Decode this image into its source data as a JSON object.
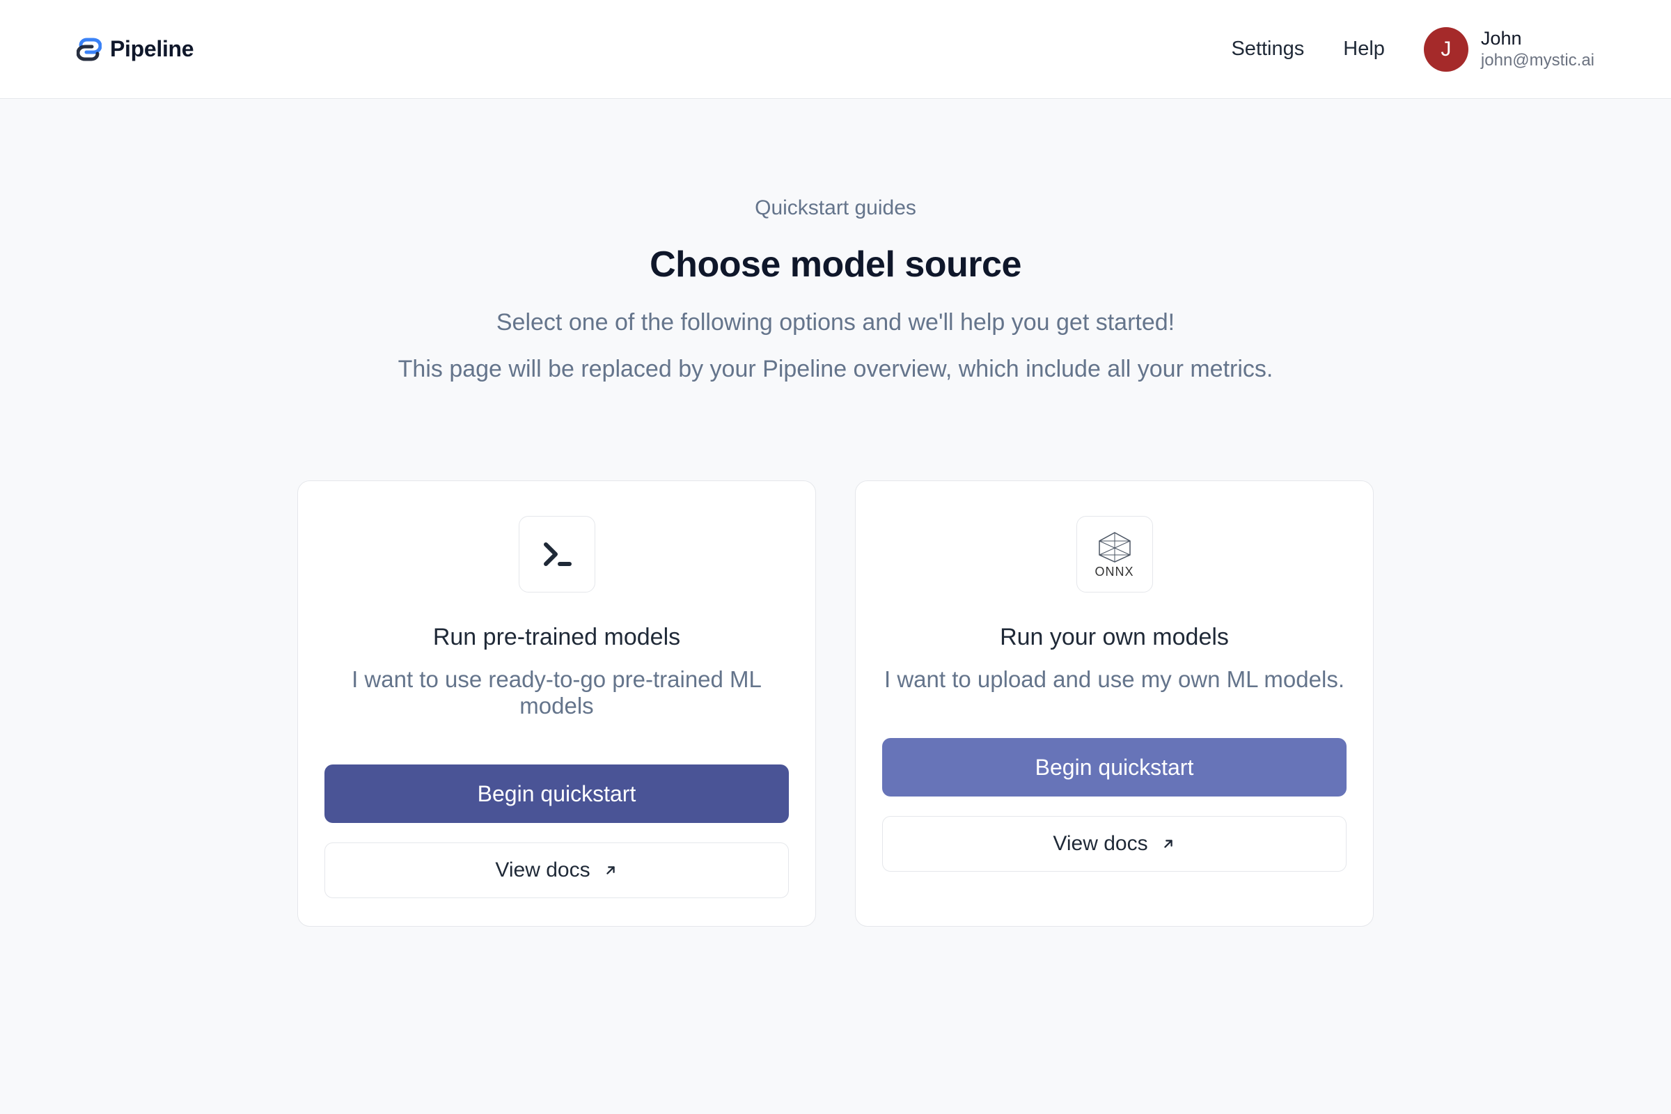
{
  "brand": {
    "name": "Pipeline"
  },
  "nav": {
    "settings": "Settings",
    "help": "Help"
  },
  "user": {
    "initial": "J",
    "name": "John",
    "email": "john@mystic.ai"
  },
  "page": {
    "eyebrow": "Quickstart guides",
    "title": "Choose model source",
    "subtitle": "Select one of the following options and we'll help you get started!",
    "subtitle2": "This page will be replaced by your Pipeline overview, which include all your metrics."
  },
  "cards": [
    {
      "icon_name": "terminal-icon",
      "icon_label": "",
      "title": "Run pre-trained models",
      "desc": "I want to use ready-to-go pre-trained ML models",
      "primary_label": "Begin quickstart",
      "secondary_label": "View docs"
    },
    {
      "icon_name": "onnx-icon",
      "icon_label": "ONNX",
      "title": "Run your own models",
      "desc": "I want to upload and use my own ML models.",
      "primary_label": "Begin quickstart",
      "secondary_label": "View docs"
    }
  ]
}
